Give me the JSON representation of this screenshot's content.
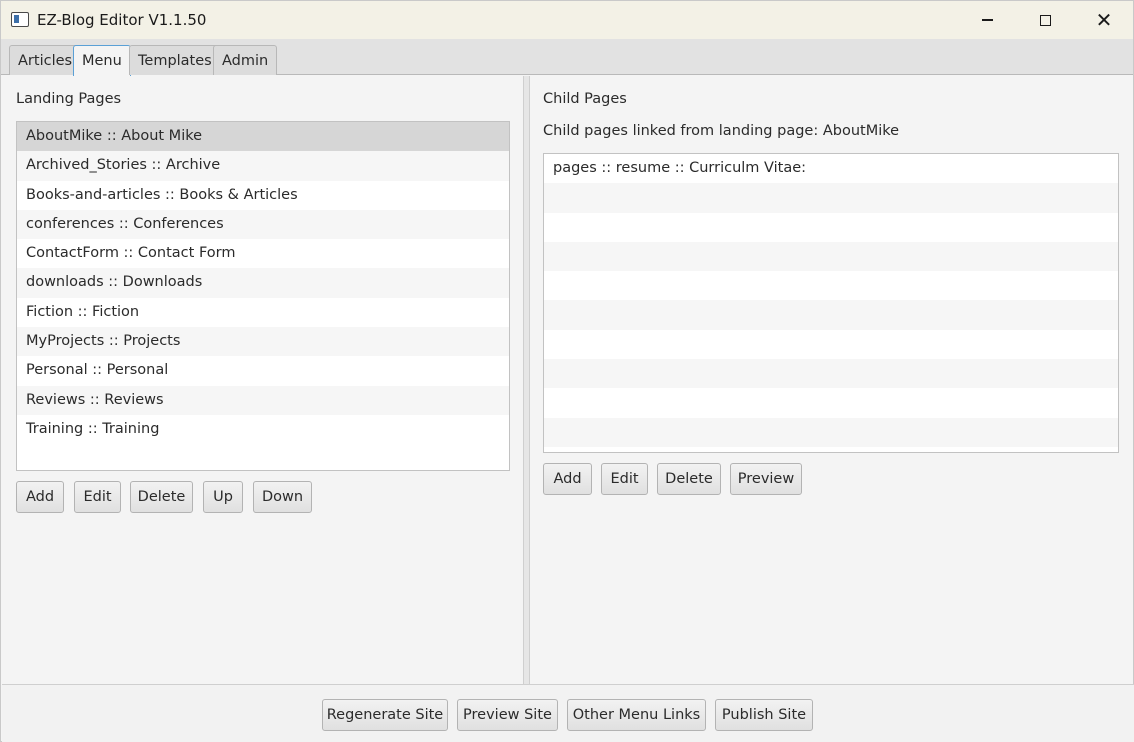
{
  "window": {
    "title": "EZ-Blog Editor V1.1.50",
    "minimize_icon": "minimize-icon",
    "maximize_icon": "maximize-icon",
    "close_glyph": "✕"
  },
  "tabs": [
    {
      "label": "Articles",
      "active": false
    },
    {
      "label": "Menu",
      "active": true
    },
    {
      "label": "Templates",
      "active": false
    },
    {
      "label": "Admin",
      "active": false
    }
  ],
  "landing": {
    "heading": "Landing Pages",
    "items": [
      "AboutMike :: About Mike",
      "Archived_Stories :: Archive",
      "Books-and-articles :: Books & Articles",
      "conferences :: Conferences",
      "ContactForm :: Contact Form",
      "downloads :: Downloads",
      "Fiction :: Fiction",
      "MyProjects :: Projects",
      "Personal :: Personal",
      "Reviews :: Reviews",
      "Training :: Training"
    ],
    "selected_index": 0,
    "buttons": {
      "add": "Add",
      "edit": "Edit",
      "delete": "Delete",
      "up": "Up",
      "down": "Down"
    }
  },
  "child": {
    "heading": "Child Pages",
    "linked_caption": "Child pages linked from landing page: AboutMike",
    "items": [
      "pages :: resume :: Curriculm Vitae:"
    ],
    "buttons": {
      "add": "Add",
      "edit": "Edit",
      "delete": "Delete",
      "preview": "Preview"
    }
  },
  "footer": {
    "regenerate": "Regenerate Site",
    "preview": "Preview Site",
    "other_links": "Other Menu Links",
    "publish": "Publish Site"
  },
  "colors": {
    "titlebar": "#f3f1e6",
    "selected_row": "#d6d6d6",
    "active_tab_border": "#5aa0d6"
  }
}
